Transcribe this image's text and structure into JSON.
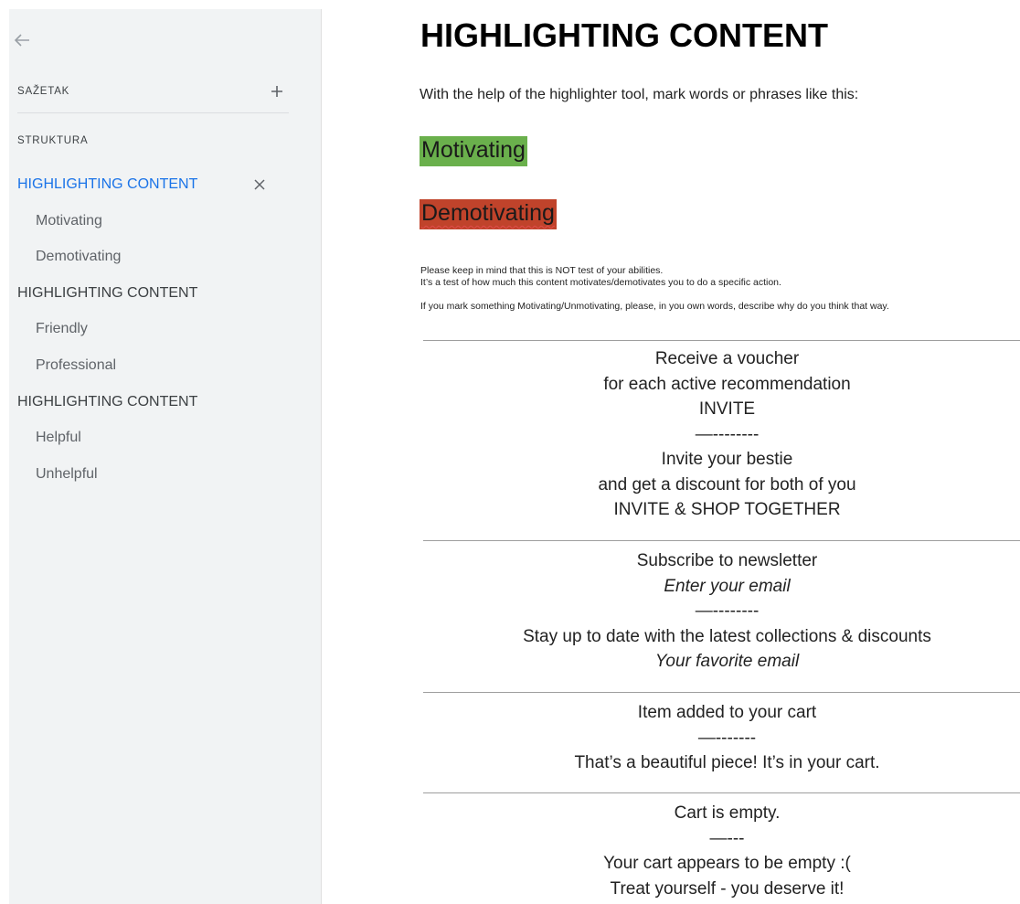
{
  "sidebar": {
    "summary_label": "SAŽETAK",
    "structure_label": "STRUKTURA",
    "outline": [
      {
        "label": "HIGHLIGHTING CONTENT",
        "level": 1,
        "active": true
      },
      {
        "label": "Motivating",
        "level": 2
      },
      {
        "label": "Demotivating",
        "level": 2
      },
      {
        "label": "HIGHLIGHTING CONTENT",
        "level": 1
      },
      {
        "label": "Friendly",
        "level": 2
      },
      {
        "label": "Professional",
        "level": 2
      },
      {
        "label": "HIGHLIGHTING CONTENT",
        "level": 1
      },
      {
        "label": "Helpful",
        "level": 2
      },
      {
        "label": "Unhelpful",
        "level": 2
      }
    ]
  },
  "document": {
    "title": "HIGHLIGHTING CONTENT",
    "intro": "With the help of the highlighter tool, mark words or phrases like this:",
    "highlights": {
      "motivating": {
        "text": "Motivating",
        "color": "#6ab04c"
      },
      "demotivating": {
        "text": "Demotivating",
        "color": "#c0432b"
      }
    },
    "notes": [
      "Please keep in mind that this is NOT test of your abilities.",
      "It’s a test of how much this content motivates/demotivates you to do a specific action.",
      "If you mark something Motivating/Unmotivating, please, in you own words, describe why do you think that way."
    ],
    "blocks": [
      {
        "lines": [
          {
            "text": "Receive a voucher"
          },
          {
            "text": "for each active recommendation"
          },
          {
            "text": "INVITE"
          },
          {
            "text": "—--------"
          },
          {
            "text": "Invite your bestie"
          },
          {
            "text": "and get a discount for both of you"
          },
          {
            "text": "INVITE & SHOP TOGETHER"
          }
        ]
      },
      {
        "lines": [
          {
            "text": "Subscribe to newsletter"
          },
          {
            "text": "Enter your email",
            "italic": true
          },
          {
            "text": "—--------"
          },
          {
            "text": "Stay up to date with the latest collections & discounts"
          },
          {
            "text": "Your favorite email",
            "italic": true
          }
        ]
      },
      {
        "lines": [
          {
            "text": "Item added to your cart"
          },
          {
            "text": "—-------"
          },
          {
            "text": "That’s a beautiful piece! It’s in your cart."
          }
        ]
      },
      {
        "lines": [
          {
            "text": "Cart is empty."
          },
          {
            "text": "—---"
          },
          {
            "text": "Your cart appears to be empty :("
          },
          {
            "text": "Treat yourself - you deserve it!"
          }
        ]
      }
    ]
  },
  "icons": {
    "back": "arrow-left-icon",
    "add": "plus-icon",
    "close": "close-icon"
  },
  "colors": {
    "active_link": "#1a73e8",
    "sidebar_bg": "#f1f3f4"
  }
}
